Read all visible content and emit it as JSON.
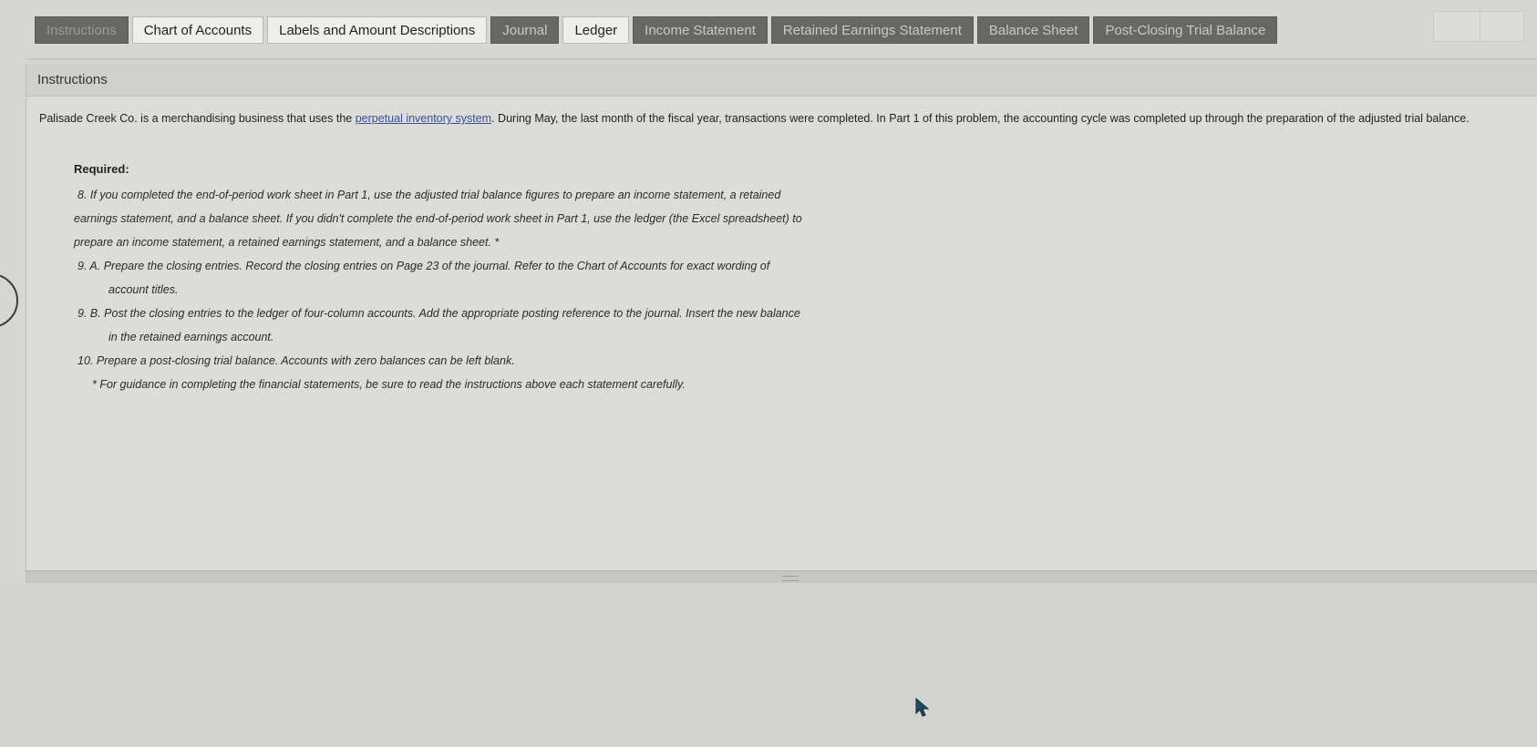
{
  "tabs": [
    {
      "label": "Instructions",
      "style": "dark",
      "active": true
    },
    {
      "label": "Chart of Accounts",
      "style": "light"
    },
    {
      "label": "Labels and Amount Descriptions",
      "style": "light"
    },
    {
      "label": "Journal",
      "style": "dark"
    },
    {
      "label": "Ledger",
      "style": "light"
    },
    {
      "label": "Income Statement",
      "style": "dark"
    },
    {
      "label": "Retained Earnings Statement",
      "style": "dark"
    },
    {
      "label": "Balance Sheet",
      "style": "dark"
    },
    {
      "label": "Post-Closing Trial Balance",
      "style": "dark"
    }
  ],
  "panel": {
    "title": "Instructions",
    "intro_before_link": "Palisade Creek Co. is a merchandising business that uses the ",
    "intro_link": "perpetual inventory system",
    "intro_after_link": ". During May, the last month of the fiscal year, transactions were completed. In Part 1 of this problem, the accounting cycle was completed up through the preparation of the adjusted trial balance.",
    "required_label": "Required:",
    "required_lines": [
      {
        "text": "8. If you completed the end-of-period work sheet in Part 1, use the adjusted trial balance figures to prepare an income statement, a retained",
        "kind": "step"
      },
      {
        "text": "earnings statement, and a balance sheet. If you didn't complete the end-of-period work sheet in Part 1, use the ledger (the Excel spreadsheet) to",
        "kind": "cont"
      },
      {
        "text": "prepare an income statement, a retained earnings statement, and a balance sheet. *",
        "kind": "cont"
      },
      {
        "text": "9. A. Prepare the closing entries. Record the closing entries on Page 23 of the journal. Refer to the Chart of Accounts for exact wording of",
        "kind": "step"
      },
      {
        "text": "account titles.",
        "kind": "indent"
      },
      {
        "text": "9. B. Post the closing entries to the ledger of four-column accounts. Add the appropriate posting reference to the journal. Insert the new balance",
        "kind": "step"
      },
      {
        "text": "in the retained earnings account.",
        "kind": "indent"
      },
      {
        "text": "10. Prepare a post-closing trial balance. Accounts with zero balances can be left blank.",
        "kind": "step"
      },
      {
        "text": "* For guidance in completing the financial statements, be sure to read the instructions above each statement carefully.",
        "kind": "note"
      }
    ]
  },
  "colors": {
    "tab_dark": "#676764",
    "tab_light": "#eeeeeb",
    "link": "#3a4f9a"
  },
  "icons": {
    "cursor": "arrow-cursor-icon"
  }
}
